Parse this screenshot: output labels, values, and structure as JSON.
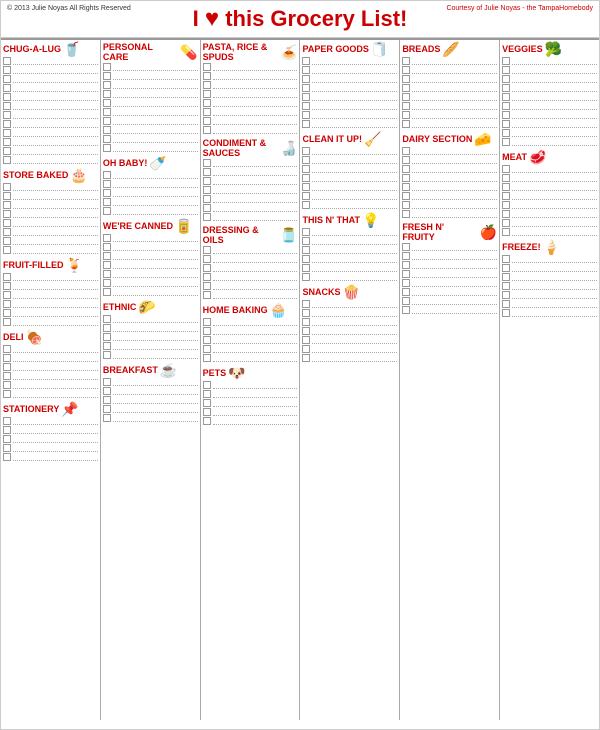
{
  "header": {
    "title": "I",
    "title2": " this Grocery List!",
    "copyright": "© 2013 Julie Noyas\nAll Rights Reserved",
    "courtesy": "Courtesy of Julie Noyas -\nthe TampaHomebody"
  },
  "columns": [
    {
      "id": "col1",
      "sections": [
        {
          "id": "chug-a-lug",
          "label": "CHUG-A-LUG",
          "icon": "🥤",
          "rows": 12
        },
        {
          "id": "store-baked",
          "label": "STORE BAKED",
          "icon": "🎂",
          "rows": 8
        },
        {
          "id": "fruit-filled",
          "label": "FRUIT-FILLED",
          "icon": "🍹",
          "rows": 6
        },
        {
          "id": "deli",
          "label": "DELI",
          "icon": "🍖",
          "rows": 6
        },
        {
          "id": "stationery",
          "label": "STATIONERY",
          "icon": "📌",
          "rows": 5
        }
      ]
    },
    {
      "id": "col2",
      "sections": [
        {
          "id": "personal-care",
          "label": "PERSONAL CARE",
          "icon": "💊",
          "rows": 10
        },
        {
          "id": "oh-baby",
          "label": "OH BABY!",
          "icon": "🍼",
          "rows": 5
        },
        {
          "id": "were-canned",
          "label": "WE'RE CANNED",
          "icon": "🥫",
          "rows": 7
        },
        {
          "id": "ethnic",
          "label": "ETHNIC",
          "icon": "🌮",
          "rows": 5
        },
        {
          "id": "breakfast",
          "label": "BREAKFAST",
          "icon": "☕",
          "rows": 5
        }
      ]
    },
    {
      "id": "col3",
      "sections": [
        {
          "id": "pasta-rice",
          "label": "PASTA, RICE & SPUDS",
          "icon": "🍝",
          "rows": 8
        },
        {
          "id": "condiment-sauces",
          "label": "CONDIMENT & SAUCES",
          "icon": "🍶",
          "rows": 7
        },
        {
          "id": "dressing-oils",
          "label": "DRESSING & OILS",
          "icon": "🫙",
          "rows": 6
        },
        {
          "id": "home-baking",
          "label": "HOME BAKING",
          "icon": "🧁",
          "rows": 5
        },
        {
          "id": "pets",
          "label": "PETS",
          "icon": "🐶",
          "rows": 5
        }
      ]
    },
    {
      "id": "col4",
      "sections": [
        {
          "id": "paper-goods",
          "label": "PAPER GOODS",
          "icon": "🧻",
          "rows": 8
        },
        {
          "id": "clean-it-up",
          "label": "CLEAN IT UP!",
          "icon": "🧹",
          "rows": 7
        },
        {
          "id": "this-n-that",
          "label": "THIS N' THAT",
          "icon": "💡",
          "rows": 6
        },
        {
          "id": "snacks",
          "label": "SNACKS",
          "icon": "🍿",
          "rows": 7
        }
      ]
    },
    {
      "id": "col5",
      "sections": [
        {
          "id": "breads",
          "label": "BREADS",
          "icon": "🥖",
          "rows": 8
        },
        {
          "id": "dairy-section",
          "label": "DAIRY SECTION",
          "icon": "🧀",
          "rows": 8
        },
        {
          "id": "fresh-n-fruity",
          "label": "FRESH N' FRUITY",
          "icon": "🍎",
          "rows": 8
        }
      ]
    },
    {
      "id": "col6",
      "sections": [
        {
          "id": "veggies",
          "label": "VEGGIES",
          "icon": "🥦",
          "rows": 10
        },
        {
          "id": "meat",
          "label": "MEAT",
          "icon": "🥩",
          "rows": 8
        },
        {
          "id": "freeze",
          "label": "FREEZE!",
          "icon": "🍦",
          "rows": 7
        }
      ]
    }
  ]
}
